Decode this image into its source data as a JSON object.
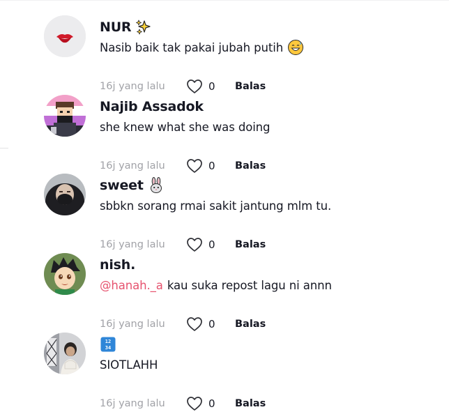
{
  "comments": [
    {
      "username": "NUR",
      "username_emoji": "sparkles-icon",
      "text": "Nasib baik tak pakai jubah putih",
      "text_emoji": "grinning-sweat-face-icon",
      "time": "16j yang lalu",
      "likes": "0",
      "reply_label": "Balas"
    },
    {
      "username": "Najib Assadok",
      "text": "she knew what she was doing",
      "time": "16j yang lalu",
      "likes": "0",
      "reply_label": "Balas"
    },
    {
      "username": "sweet",
      "username_emoji": "rabbit-face-icon",
      "text": "sbbkn sorang rmai sakit jantung mlm tu.",
      "time": "16j yang lalu",
      "likes": "0",
      "reply_label": "Balas"
    },
    {
      "username": "nish.",
      "mention": "@hanah._a",
      "text": "kau suka repost lagu ni annn",
      "time": "16j yang lalu",
      "likes": "0",
      "reply_label": "Balas"
    },
    {
      "username_emoji": "input-numbers-icon",
      "username_emoji_text": "1234",
      "text": "SIOTLAHH",
      "time": "16j yang lalu",
      "likes": "0",
      "reply_label": "Balas"
    }
  ],
  "colors": {
    "text": "#161823",
    "secondary": "#a1a2a7",
    "mention": "#e6536f"
  }
}
